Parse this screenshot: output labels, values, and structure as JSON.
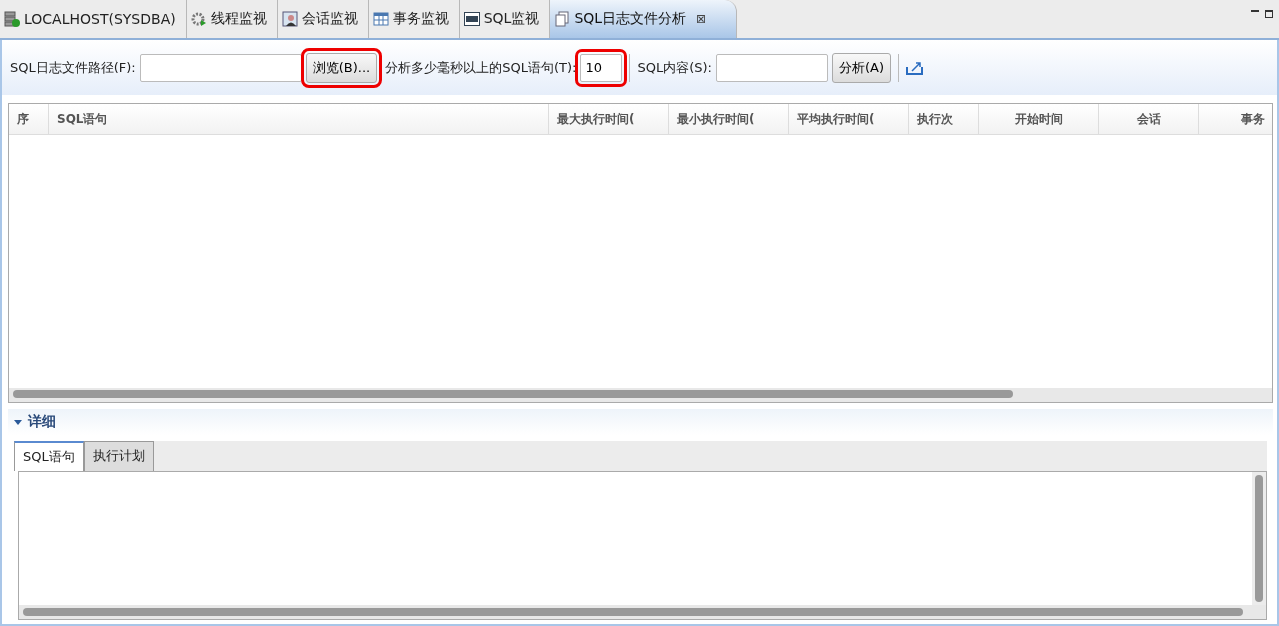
{
  "tabs": [
    {
      "label": "LOCALHOST(SYSDBA)",
      "kind": "server",
      "selected": false,
      "closable": false
    },
    {
      "label": "线程监视",
      "kind": "gear",
      "selected": false,
      "closable": false
    },
    {
      "label": "会话监视",
      "kind": "user",
      "selected": false,
      "closable": false
    },
    {
      "label": "事务监视",
      "kind": "table",
      "selected": false,
      "closable": false
    },
    {
      "label": "SQL监视",
      "kind": "sql",
      "selected": false,
      "closable": false
    },
    {
      "label": "SQL日志文件分析",
      "kind": "pages",
      "selected": true,
      "closable": true,
      "close_glyph": "⊠"
    }
  ],
  "toolbar": {
    "path_label": "SQL日志文件路径(F):",
    "browse_button": {
      "label": "浏览(B)...",
      "highlighted": true
    },
    "threshold_label": "分析多少毫秒以上的SQL语句(T):",
    "threshold": {
      "value": "10",
      "highlighted": true
    },
    "content_label": "SQL内容(S):",
    "analyze_button": "分析(A)"
  },
  "table": {
    "columns": [
      "序",
      "SQL语句",
      "最大执行时间(",
      "最小执行时间(",
      "平均执行时间(",
      "执行次",
      "开始时间",
      "会话",
      "事务"
    ]
  },
  "detail": {
    "title": "详细",
    "expanded": true,
    "tabs": [
      {
        "label": "SQL语句",
        "selected": true
      },
      {
        "label": "执行计划",
        "selected": false
      }
    ]
  }
}
